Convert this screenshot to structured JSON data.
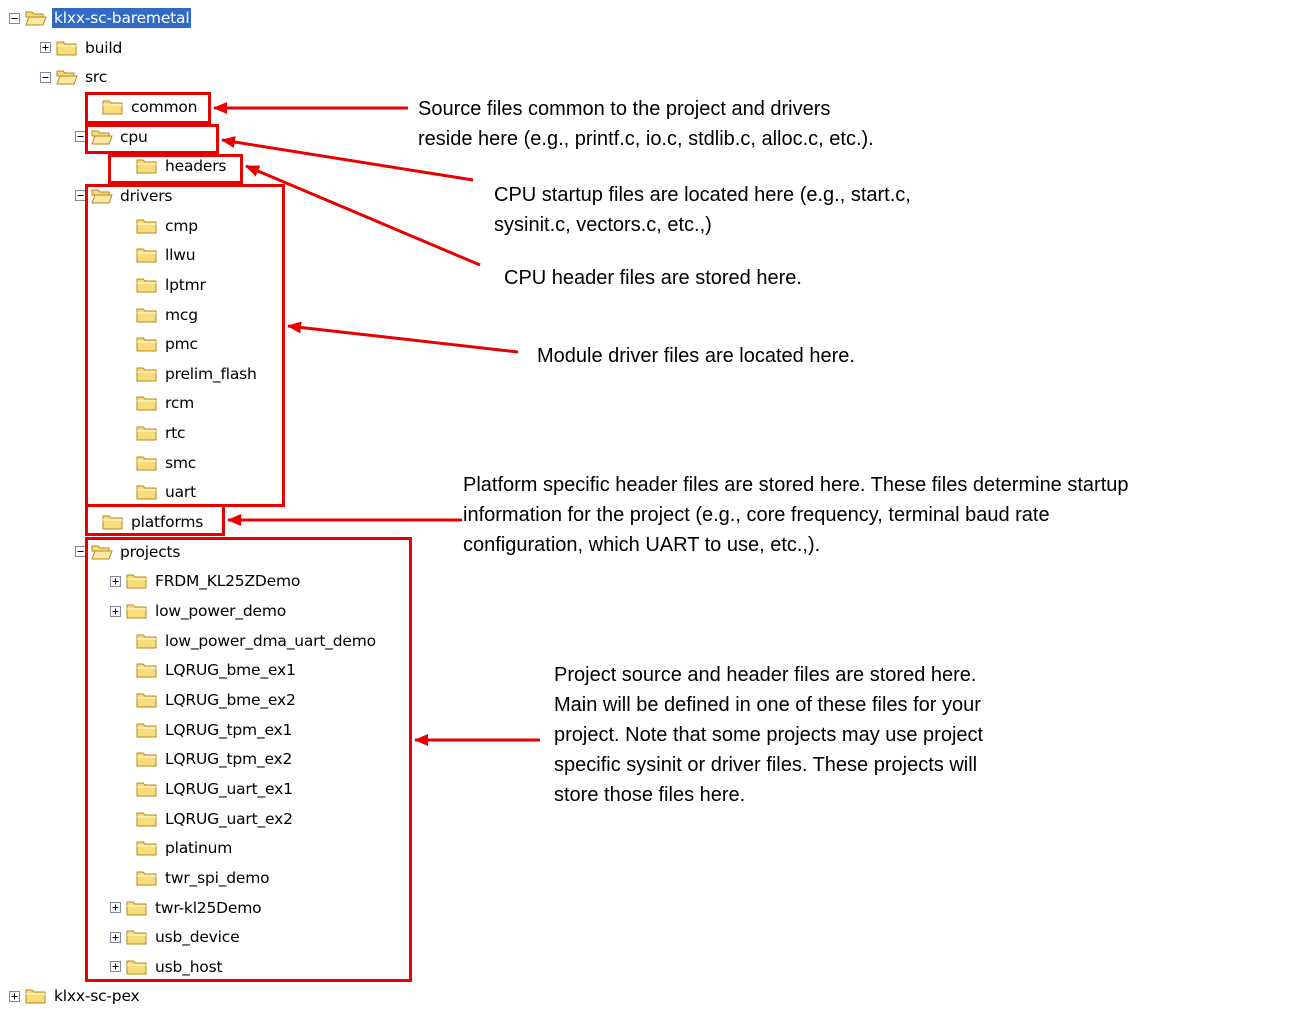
{
  "colors": {
    "annotation": "#e60000",
    "selection": "#316ac5",
    "folder_fill": "#f7dc7a",
    "folder_stroke": "#b8871d"
  },
  "tree": [
    {
      "id": "klxx-sc-baremetal",
      "label": "klxx-sc-baremetal",
      "depth": 0,
      "expander": "minus",
      "selected": true,
      "icon": "folder-open-icon"
    },
    {
      "id": "build",
      "label": "build",
      "depth": 1,
      "expander": "plus",
      "icon": "folder-icon"
    },
    {
      "id": "src",
      "label": "src",
      "depth": 1,
      "expander": "minus",
      "icon": "folder-open-icon"
    },
    {
      "id": "common",
      "label": "common",
      "depth": 2,
      "expander": "none",
      "icon": "folder-icon"
    },
    {
      "id": "cpu",
      "label": "cpu",
      "depth": 2,
      "expander": "minus",
      "icon": "folder-open-icon"
    },
    {
      "id": "headers",
      "label": "headers",
      "depth": 3,
      "expander": "none",
      "icon": "folder-icon"
    },
    {
      "id": "drivers",
      "label": "drivers",
      "depth": 2,
      "expander": "minus",
      "icon": "folder-open-icon"
    },
    {
      "id": "cmp",
      "label": "cmp",
      "depth": 3,
      "expander": "none",
      "icon": "folder-icon"
    },
    {
      "id": "llwu",
      "label": "llwu",
      "depth": 3,
      "expander": "none",
      "icon": "folder-icon"
    },
    {
      "id": "lptmr",
      "label": "lptmr",
      "depth": 3,
      "expander": "none",
      "icon": "folder-icon"
    },
    {
      "id": "mcg",
      "label": "mcg",
      "depth": 3,
      "expander": "none",
      "icon": "folder-icon"
    },
    {
      "id": "pmc",
      "label": "pmc",
      "depth": 3,
      "expander": "none",
      "icon": "folder-icon"
    },
    {
      "id": "prelim_flash",
      "label": "prelim_flash",
      "depth": 3,
      "expander": "none",
      "icon": "folder-icon"
    },
    {
      "id": "rcm",
      "label": "rcm",
      "depth": 3,
      "expander": "none",
      "icon": "folder-icon"
    },
    {
      "id": "rtc",
      "label": "rtc",
      "depth": 3,
      "expander": "none",
      "icon": "folder-icon"
    },
    {
      "id": "smc",
      "label": "smc",
      "depth": 3,
      "expander": "none",
      "icon": "folder-icon"
    },
    {
      "id": "uart",
      "label": "uart",
      "depth": 3,
      "expander": "none",
      "icon": "folder-icon"
    },
    {
      "id": "platforms",
      "label": "platforms",
      "depth": 2,
      "expander": "none",
      "icon": "folder-icon"
    },
    {
      "id": "projects",
      "label": "projects",
      "depth": 2,
      "expander": "minus",
      "icon": "folder-open-icon"
    },
    {
      "id": "FRDM_KL25ZDemo",
      "label": "FRDM_KL25ZDemo",
      "depth": 3,
      "expander": "plus",
      "icon": "folder-icon"
    },
    {
      "id": "low_power_demo",
      "label": "low_power_demo",
      "depth": 3,
      "expander": "plus",
      "icon": "folder-icon"
    },
    {
      "id": "low_power_dma_uart_demo",
      "label": "low_power_dma_uart_demo",
      "depth": 3,
      "expander": "none",
      "icon": "folder-icon"
    },
    {
      "id": "LQRUG_bme_ex1",
      "label": "LQRUG_bme_ex1",
      "depth": 3,
      "expander": "none",
      "icon": "folder-icon"
    },
    {
      "id": "LQRUG_bme_ex2",
      "label": "LQRUG_bme_ex2",
      "depth": 3,
      "expander": "none",
      "icon": "folder-icon"
    },
    {
      "id": "LQRUG_tpm_ex1",
      "label": "LQRUG_tpm_ex1",
      "depth": 3,
      "expander": "none",
      "icon": "folder-icon"
    },
    {
      "id": "LQRUG_tpm_ex2",
      "label": "LQRUG_tpm_ex2",
      "depth": 3,
      "expander": "none",
      "icon": "folder-icon"
    },
    {
      "id": "LQRUG_uart_ex1",
      "label": "LQRUG_uart_ex1",
      "depth": 3,
      "expander": "none",
      "icon": "folder-icon"
    },
    {
      "id": "LQRUG_uart_ex2",
      "label": "LQRUG_uart_ex2",
      "depth": 3,
      "expander": "none",
      "icon": "folder-icon"
    },
    {
      "id": "platinum",
      "label": "platinum",
      "depth": 3,
      "expander": "none",
      "icon": "folder-icon"
    },
    {
      "id": "twr_spi_demo",
      "label": "twr_spi_demo",
      "depth": 3,
      "expander": "none",
      "icon": "folder-icon"
    },
    {
      "id": "twr-kl25Demo",
      "label": "twr-kl25Demo",
      "depth": 3,
      "expander": "plus",
      "icon": "folder-icon"
    },
    {
      "id": "usb_device",
      "label": "usb_device",
      "depth": 3,
      "expander": "plus",
      "icon": "folder-icon"
    },
    {
      "id": "usb_host",
      "label": "usb_host",
      "depth": 3,
      "expander": "plus",
      "icon": "folder-icon"
    },
    {
      "id": "klxx-sc-pex",
      "label": "klxx-sc-pex",
      "depth": 0,
      "expander": "plus",
      "icon": "folder-icon"
    }
  ],
  "annotations": {
    "common": [
      "Source files common to the project and drivers",
      "reside here (e.g., printf.c, io.c, stdlib.c, alloc.c, etc.)."
    ],
    "cpu": [
      "CPU startup files are located here (e.g., start.c,",
      "sysinit.c, vectors.c, etc.,)"
    ],
    "headers": [
      "CPU header files are stored here."
    ],
    "drivers": [
      "Module driver files are located here."
    ],
    "platforms": [
      "Platform specific header files are stored here.  These files determine startup",
      "information for the project (e.g., core frequency, terminal baud rate",
      "configuration, which UART to use, etc.,)."
    ],
    "projects": [
      "Project source and header files are stored here.",
      "Main will be defined in one of these files for your",
      "project.  Note that some projects may use project",
      "specific sysinit or driver files.  These projects will",
      "store those files here."
    ]
  }
}
